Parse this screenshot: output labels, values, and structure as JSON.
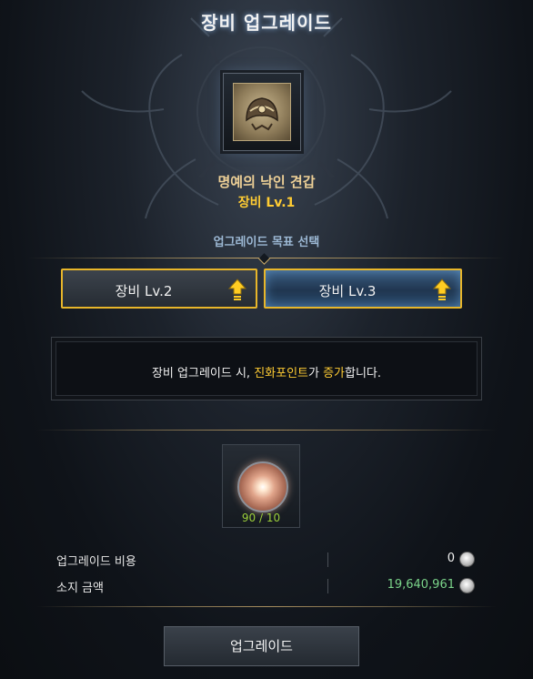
{
  "window": {
    "title": "장비 업그레이드"
  },
  "item": {
    "name": "명예의 낙인 견갑",
    "level": "장비 Lv.1"
  },
  "target": {
    "label": "업그레이드 목표 선택",
    "options": [
      {
        "label": "장비 Lv.2",
        "selected": false
      },
      {
        "label": "장비 Lv.3",
        "selected": true
      }
    ]
  },
  "info": {
    "prefix": "장비 업그레이드 시, ",
    "highlight1": "진화포인트",
    "middle": "가 ",
    "highlight2": "증가",
    "suffix": "합니다."
  },
  "material": {
    "count": "90 / 10"
  },
  "cost": {
    "upgrade_cost_label": "업그레이드 비용",
    "upgrade_cost_value": "0",
    "owned_label": "소지 금액",
    "owned_value": "19,640,961"
  },
  "actions": {
    "upgrade_label": "업그레이드"
  },
  "colors": {
    "accent_gold": "#ffcc33",
    "item_name": "#eccf96",
    "owned_value": "#7bd48a",
    "material_count": "#9ccf3a",
    "selected_border": "#e8b62a"
  },
  "icons": {
    "upgrade_arrow": "arrow-up-icon",
    "currency": "silver-coin-icon",
    "material": "evolution-orb-icon"
  }
}
